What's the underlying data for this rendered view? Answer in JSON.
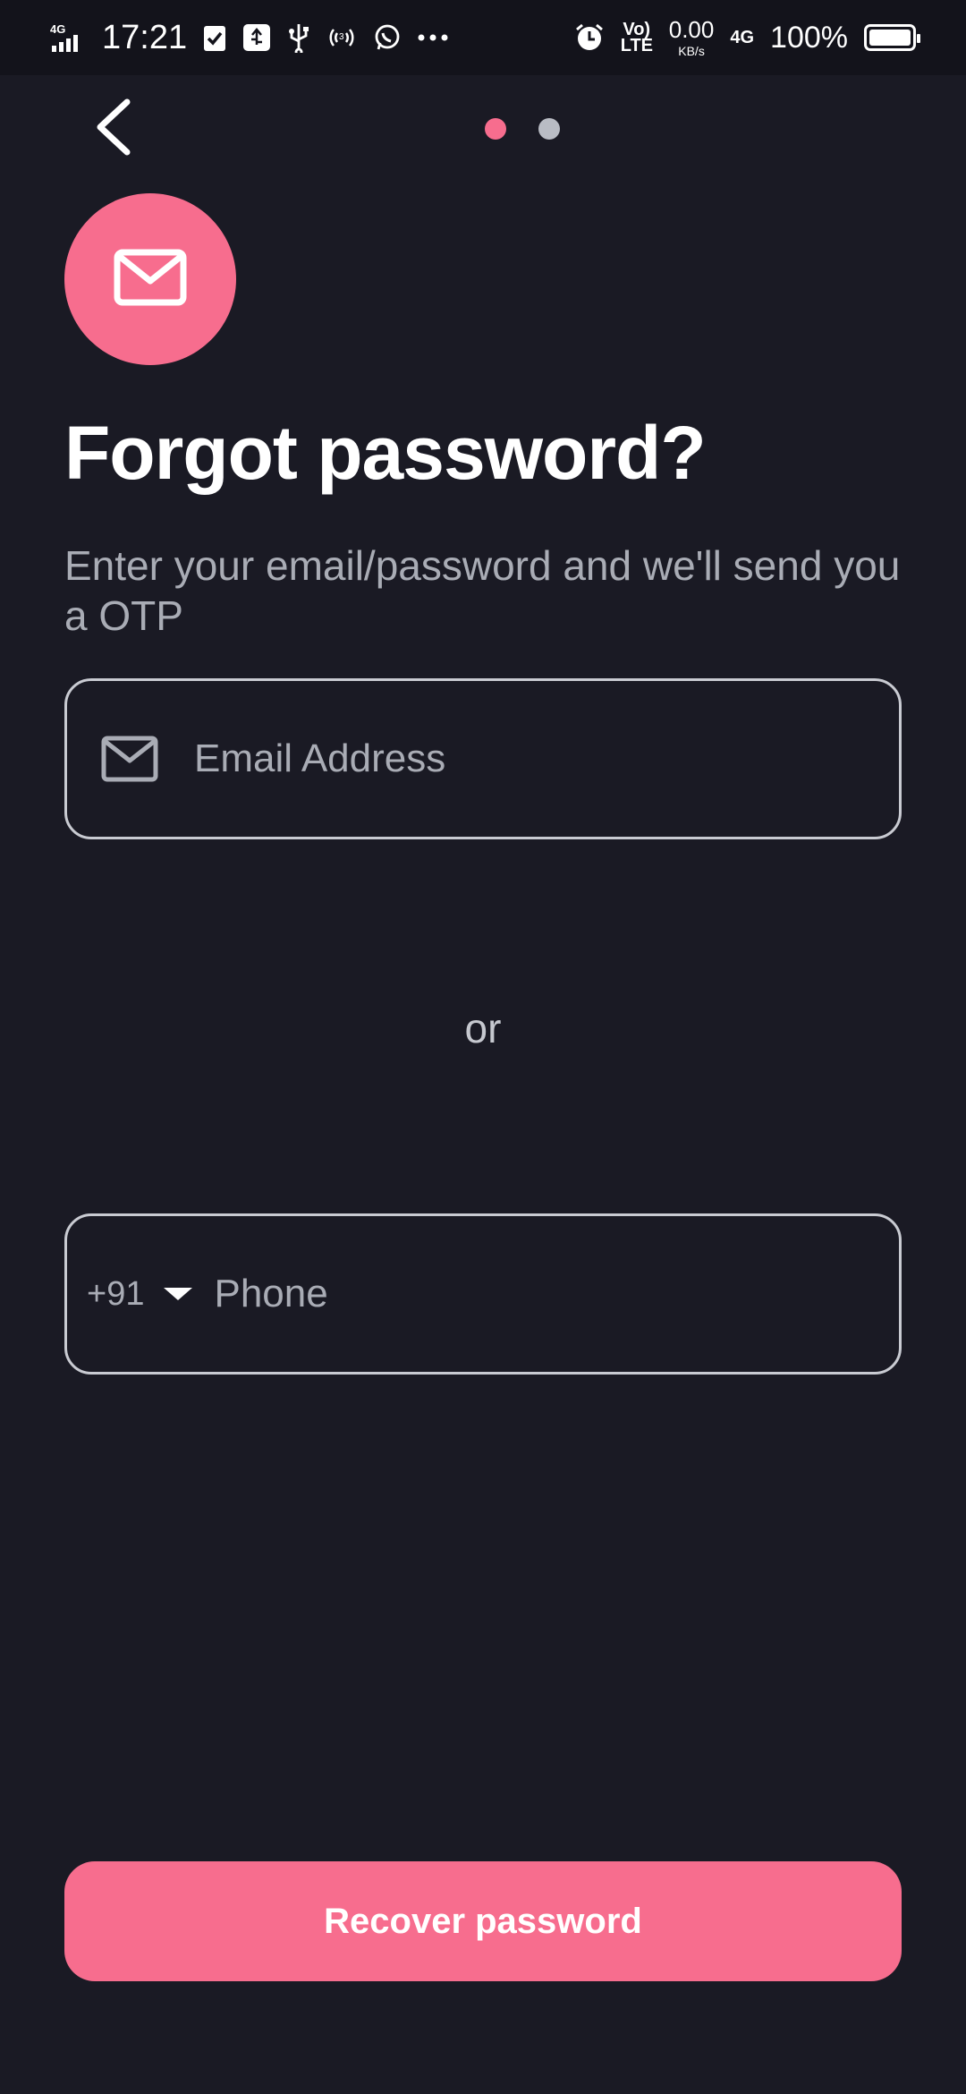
{
  "status_bar": {
    "network": "4G",
    "time": "17:21",
    "volte": "Vo) LTE",
    "speed_value": "0.00",
    "speed_unit": "KB/s",
    "network_right": "4G",
    "battery": "100%",
    "icons": [
      "signal-icon",
      "clipboard-check-icon",
      "usb-debug-icon",
      "usb-icon",
      "hotspot-icon",
      "whatsapp-icon",
      "more-icon",
      "alarm-icon",
      "battery-icon"
    ]
  },
  "nav": {
    "back_icon": "chevron-left-icon",
    "pager_total": 2,
    "pager_active_index": 0
  },
  "header": {
    "badge_icon": "mail-icon",
    "title": "Forgot password?",
    "subtitle": "Enter your email/password and we'll send you a OTP"
  },
  "form": {
    "email": {
      "placeholder": "Email Address",
      "value": "",
      "icon": "mail-icon"
    },
    "separator": "or",
    "phone": {
      "country_code": "+91",
      "placeholder": "Phone",
      "value": ""
    }
  },
  "actions": {
    "recover_label": "Recover password"
  },
  "colors": {
    "background": "#1a1a24",
    "accent": "#f76d8e",
    "muted_text": "#a9acb5",
    "border": "#c9cbd2"
  }
}
